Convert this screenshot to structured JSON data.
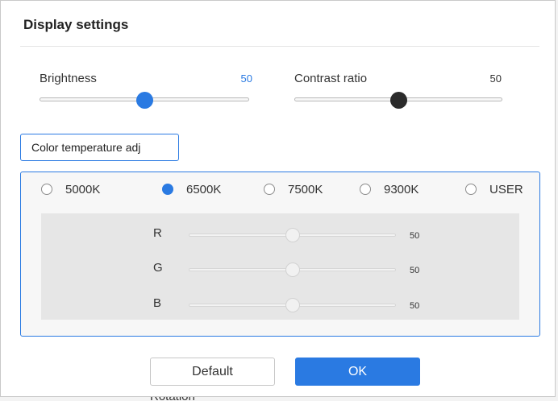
{
  "dialog": {
    "title": "Display settings"
  },
  "brightness": {
    "label": "Brightness",
    "value": "50",
    "value_color": "#2a7ae2",
    "level": 50,
    "max": 100
  },
  "contrast": {
    "label": "Contrast ratio",
    "value": "50",
    "value_color": "#333333",
    "level": 50,
    "max": 100
  },
  "color_temperature": {
    "dropdown_value": "Color temperature adj",
    "options": [
      {
        "label": "5000K",
        "checked": false
      },
      {
        "label": "6500K",
        "checked": true
      },
      {
        "label": "7500K",
        "checked": false
      },
      {
        "label": "9300K",
        "checked": false
      },
      {
        "label": "USER",
        "checked": false
      }
    ],
    "rgb": [
      {
        "label": "R",
        "value": "50",
        "level": 50
      },
      {
        "label": "G",
        "value": "50",
        "level": 50
      },
      {
        "label": "B",
        "value": "50",
        "level": 50
      }
    ]
  },
  "buttons": {
    "default_label": "Default",
    "ok_label": "OK"
  },
  "background": {
    "partial_text": "Rotation"
  },
  "colors": {
    "accent": "#2a7ae2",
    "border": "#c9c9c9"
  }
}
